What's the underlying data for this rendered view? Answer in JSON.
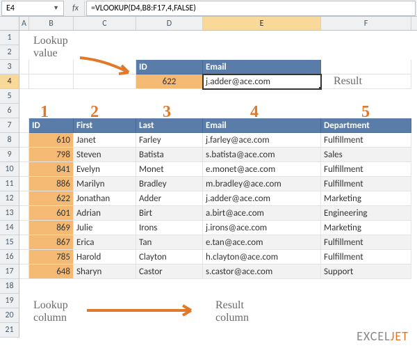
{
  "cell_ref": "E4",
  "formula": "=VLOOKUP(D4,B8:F17,4,FALSE)",
  "columns": [
    "A",
    "B",
    "C",
    "D",
    "E",
    "F"
  ],
  "lookup_head": {
    "id": "ID",
    "email": "Email"
  },
  "lookup": {
    "id": "622",
    "email": "j.adder@ace.com"
  },
  "col_nums": [
    "1",
    "2",
    "3",
    "4",
    "5"
  ],
  "table_head": {
    "id": "ID",
    "first": "First",
    "last": "Last",
    "email": "Email",
    "dept": "Department"
  },
  "rows": [
    {
      "id": "610",
      "first": "Janet",
      "last": "Farley",
      "email": "j.farley@ace.com",
      "dept": "Fulfillment"
    },
    {
      "id": "798",
      "first": "Steven",
      "last": "Batista",
      "email": "s.batista@ace.com",
      "dept": "Sales"
    },
    {
      "id": "841",
      "first": "Evelyn",
      "last": "Monet",
      "email": "e.monet@ace.com",
      "dept": "Fulfillment"
    },
    {
      "id": "886",
      "first": "Marilyn",
      "last": "Bradley",
      "email": "m.bradley@ace.com",
      "dept": "Fulfillment"
    },
    {
      "id": "622",
      "first": "Jonathan",
      "last": "Adder",
      "email": "j.adder@ace.com",
      "dept": "Marketing"
    },
    {
      "id": "601",
      "first": "Adrian",
      "last": "Birt",
      "email": "a.birt@ace.com",
      "dept": "Engineering"
    },
    {
      "id": "869",
      "first": "Julie",
      "last": "Irons",
      "email": "j.irons@ace.com",
      "dept": "Marketing"
    },
    {
      "id": "867",
      "first": "Erica",
      "last": "Tan",
      "email": "e.tan@ace.com",
      "dept": "Fulfillment"
    },
    {
      "id": "785",
      "first": "Harold",
      "last": "Clayton",
      "email": "h.clayton@ace.com",
      "dept": "Fulfillment"
    },
    {
      "id": "648",
      "first": "Sharyn",
      "last": "Castor",
      "email": "s.castor@ace.com",
      "dept": "Support"
    }
  ],
  "annotations": {
    "lookup_value": "Lookup\nvalue",
    "result": "Result",
    "lookup_column": "Lookup\ncolumn",
    "result_column": "Result\ncolumn"
  },
  "logo": {
    "a": "EXCEL",
    "b": "JET"
  },
  "chart_data": {
    "type": "table",
    "title": "VLOOKUP example",
    "lookup_id": 622,
    "result_email": "j.adder@ace.com",
    "columns": [
      "ID",
      "First",
      "Last",
      "Email",
      "Department"
    ],
    "records": [
      [
        610,
        "Janet",
        "Farley",
        "j.farley@ace.com",
        "Fulfillment"
      ],
      [
        798,
        "Steven",
        "Batista",
        "s.batista@ace.com",
        "Sales"
      ],
      [
        841,
        "Evelyn",
        "Monet",
        "e.monet@ace.com",
        "Fulfillment"
      ],
      [
        886,
        "Marilyn",
        "Bradley",
        "m.bradley@ace.com",
        "Fulfillment"
      ],
      [
        622,
        "Jonathan",
        "Adder",
        "j.adder@ace.com",
        "Marketing"
      ],
      [
        601,
        "Adrian",
        "Birt",
        "a.birt@ace.com",
        "Engineering"
      ],
      [
        869,
        "Julie",
        "Irons",
        "j.irons@ace.com",
        "Marketing"
      ],
      [
        867,
        "Erica",
        "Tan",
        "e.tan@ace.com",
        "Fulfillment"
      ],
      [
        785,
        "Harold",
        "Clayton",
        "h.clayton@ace.com",
        "Fulfillment"
      ],
      [
        648,
        "Sharyn",
        "Castor",
        "s.castor@ace.com",
        "Support"
      ]
    ]
  }
}
